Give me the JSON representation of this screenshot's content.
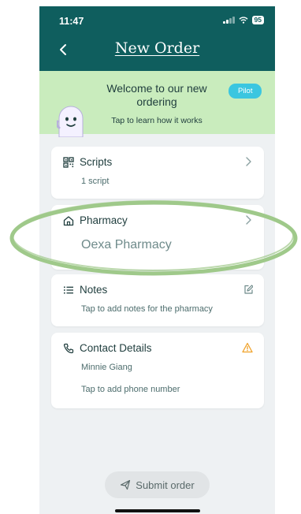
{
  "status_bar": {
    "time": "11:47",
    "battery": "95"
  },
  "header": {
    "title": "New Order"
  },
  "banner": {
    "title": "Welcome to our new ordering",
    "subtitle": "Tap to learn how it works",
    "badge": "Pilot"
  },
  "scripts": {
    "title": "Scripts",
    "subtitle": "1 script"
  },
  "pharmacy": {
    "title": "Pharmacy",
    "value": "Oexa Pharmacy"
  },
  "notes": {
    "title": "Notes",
    "subtitle": "Tap to add notes for the pharmacy"
  },
  "contact": {
    "title": "Contact Details",
    "name": "Minnie Giang",
    "phone_prompt": "Tap to add phone number"
  },
  "submit": {
    "label": "Submit order"
  },
  "colors": {
    "header_bg": "#0f5e5e",
    "banner_bg": "#c9ecbd",
    "badge_bg": "#3bc6e0",
    "warning": "#f0a22a",
    "highlight_oval": "#9fc98a"
  },
  "icons": {
    "back": "chevron-left-icon",
    "scripts": "qr-code-icon",
    "pharmacy": "home-icon",
    "notes": "list-icon",
    "contact": "phone-icon",
    "edit": "edit-icon",
    "warning": "warning-icon",
    "submit": "send-icon"
  }
}
